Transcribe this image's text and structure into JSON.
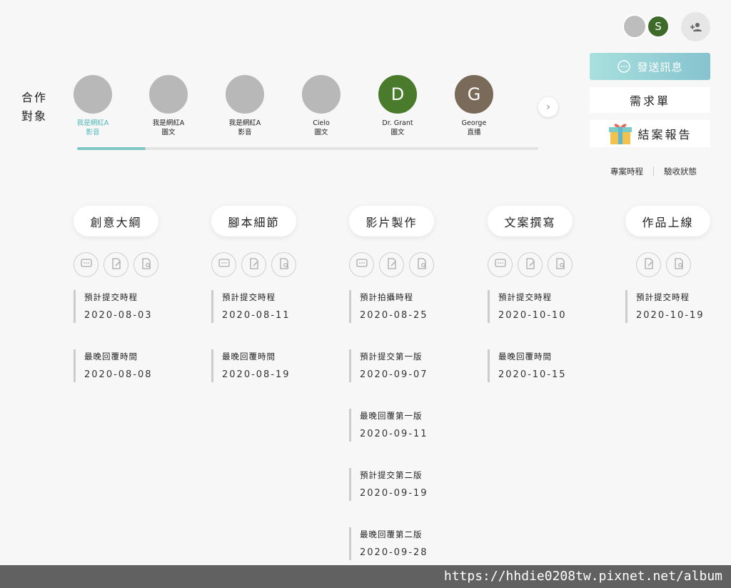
{
  "header": {
    "member_initial": "S",
    "accent_color": "#7fc8c6"
  },
  "actions": {
    "send_message": "發送訊息",
    "requirement_form": "需求單",
    "final_report": "結案報告"
  },
  "links": {
    "schedule": "專案時程",
    "acceptance": "驗收狀態"
  },
  "collab": {
    "title_line1": "合作",
    "title_line2": "對象",
    "items": [
      {
        "name": "我是網紅A",
        "type": "影音",
        "initial": "",
        "color": "#b8b8b8",
        "active": true
      },
      {
        "name": "我是網紅A",
        "type": "圖文",
        "initial": "",
        "color": "#b8b8b8"
      },
      {
        "name": "我是網紅A",
        "type": "影音",
        "initial": "",
        "color": "#b8b8b8"
      },
      {
        "name": "Cielo",
        "type": "圖文",
        "initial": "",
        "color": "#b8b8b8"
      },
      {
        "name": "Dr. Grant",
        "type": "圖文",
        "initial": "D",
        "color": "#4a7a2c"
      },
      {
        "name": "George",
        "type": "直播",
        "initial": "G",
        "color": "#7a6a5a"
      }
    ]
  },
  "stages": [
    {
      "title": "創意大綱",
      "entries": [
        {
          "label": "預計提交時程",
          "date": "2020-08-03"
        },
        {
          "label": "最晚回覆時間",
          "date": "2020-08-08"
        }
      ]
    },
    {
      "title": "腳本細節",
      "entries": [
        {
          "label": "預計提交時程",
          "date": "2020-08-11"
        },
        {
          "label": "最晚回覆時間",
          "date": "2020-08-19"
        }
      ]
    },
    {
      "title": "影片製作",
      "entries": [
        {
          "label": "預計拍攝時程",
          "date": "2020-08-25"
        },
        {
          "label": "預計提交第一版",
          "date": "2020-09-07"
        },
        {
          "label": "最晚回覆第一版",
          "date": "2020-09-11"
        },
        {
          "label": "預計提交第二版",
          "date": "2020-09-19"
        },
        {
          "label": "最晚回覆第二版",
          "date": "2020-09-28"
        }
      ]
    },
    {
      "title": "文案撰寫",
      "entries": [
        {
          "label": "預計提交時程",
          "date": "2020-10-10"
        },
        {
          "label": "最晚回覆時間",
          "date": "2020-10-15"
        }
      ]
    },
    {
      "title": "作品上線",
      "entries": [
        {
          "label": "預計提交時程",
          "date": "2020-10-19"
        }
      ]
    }
  ],
  "watermark": "https://hhdie0208tw.pixnet.net/album"
}
